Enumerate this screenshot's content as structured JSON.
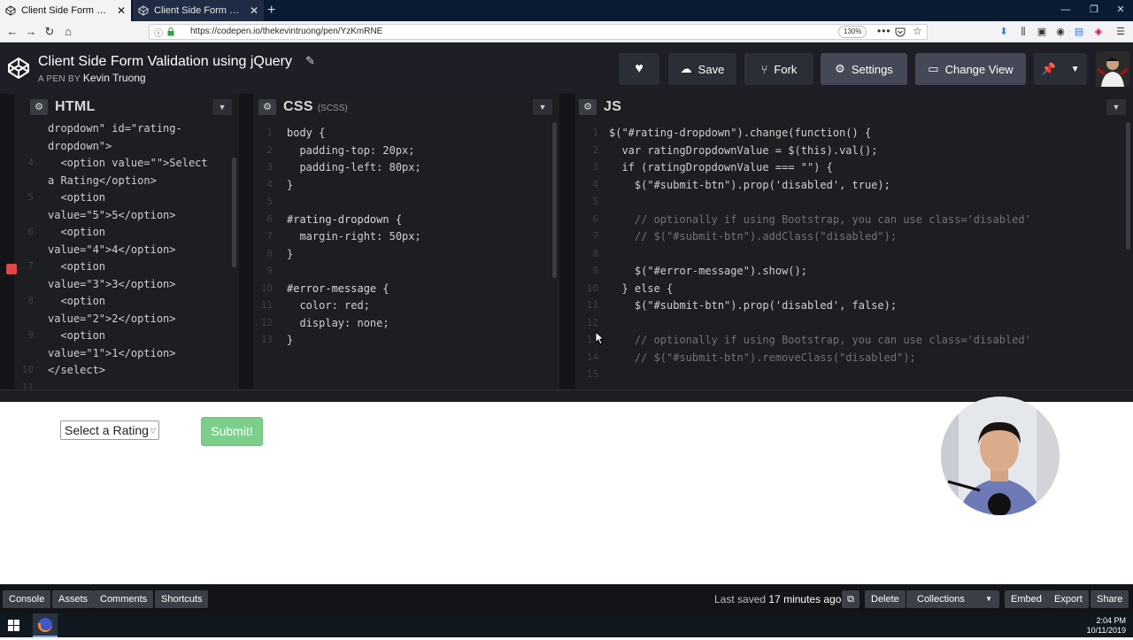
{
  "browser": {
    "tabs": [
      {
        "title": "Client Side Form Validation usi",
        "active": true
      },
      {
        "title": "Client Side Form Validation usi",
        "active": false
      }
    ],
    "url": "https://codepen.io/thekevintruong/pen/YzKmRNE",
    "zoom": "130%"
  },
  "header": {
    "title": "Client Side Form Validation using jQuery",
    "byline_prefix": "A PEN BY",
    "author": "Kevin Truong",
    "buttons": {
      "save": "Save",
      "fork": "Fork",
      "settings": "Settings",
      "change_view": "Change View"
    }
  },
  "panes": {
    "html": {
      "title": "HTML",
      "sub": ""
    },
    "css": {
      "title": "CSS",
      "sub": "(SCSS)"
    },
    "js": {
      "title": "JS",
      "sub": ""
    }
  },
  "html_code": [
    {
      "n": "",
      "t": "dropdown\" id=\"rating-",
      "indent": 0
    },
    {
      "n": "",
      "t": "dropdown\">",
      "indent": 0
    },
    {
      "n": "4",
      "t": "  <option value=\"\">Select",
      "indent": 0
    },
    {
      "n": "",
      "t": "a Rating</option>",
      "indent": 0
    },
    {
      "n": "5",
      "t": "  <option",
      "indent": 0
    },
    {
      "n": "",
      "t": "value=\"5\">5</option>",
      "indent": 0
    },
    {
      "n": "6",
      "t": "  <option",
      "indent": 0
    },
    {
      "n": "",
      "t": "value=\"4\">4</option>",
      "indent": 0
    },
    {
      "n": "7",
      "t": "  <option",
      "indent": 0
    },
    {
      "n": "",
      "t": "value=\"3\">3</option>",
      "indent": 0
    },
    {
      "n": "8",
      "t": "  <option",
      "indent": 0
    },
    {
      "n": "",
      "t": "value=\"2\">2</option>",
      "indent": 0
    },
    {
      "n": "9",
      "t": "  <option",
      "indent": 0
    },
    {
      "n": "",
      "t": "value=\"1\">1</option>",
      "indent": 0
    },
    {
      "n": "10",
      "t": "</select>",
      "indent": 0
    },
    {
      "n": "11",
      "t": "",
      "indent": 0
    }
  ],
  "css_code": [
    {
      "n": "1",
      "t": "body {"
    },
    {
      "n": "2",
      "t": "  padding-top: 20px;"
    },
    {
      "n": "3",
      "t": "  padding-left: 80px;"
    },
    {
      "n": "4",
      "t": "}"
    },
    {
      "n": "5",
      "t": ""
    },
    {
      "n": "6",
      "t": "#rating-dropdown {"
    },
    {
      "n": "7",
      "t": "  margin-right: 50px;"
    },
    {
      "n": "8",
      "t": "}"
    },
    {
      "n": "9",
      "t": ""
    },
    {
      "n": "10",
      "t": "#error-message {"
    },
    {
      "n": "11",
      "t": "  color: red;"
    },
    {
      "n": "12",
      "t": "  display: none;"
    },
    {
      "n": "13",
      "t": "}"
    }
  ],
  "js_code": [
    {
      "n": "1",
      "t": "$(\"#rating-dropdown\").change(function() {"
    },
    {
      "n": "2",
      "t": "  var ratingDropdownValue = $(this).val();"
    },
    {
      "n": "3",
      "t": "  if (ratingDropdownValue === \"\") {"
    },
    {
      "n": "4",
      "t": "    $(\"#submit-btn\").prop('disabled', true);"
    },
    {
      "n": "5",
      "t": ""
    },
    {
      "n": "6",
      "t": "    // optionally if using Bootstrap, you can use class='disabled'"
    },
    {
      "n": "7",
      "t": "    // $(\"#submit-btn\").addClass(\"disabled\");"
    },
    {
      "n": "8",
      "t": ""
    },
    {
      "n": "9",
      "t": "    $(\"#error-message\").show();"
    },
    {
      "n": "10",
      "t": "  } else {"
    },
    {
      "n": "11",
      "t": "    $(\"#submit-btn\").prop('disabled', false);"
    },
    {
      "n": "12",
      "t": ""
    },
    {
      "n": "13",
      "t": "    // optionally if using Bootstrap, you can use class='disabled'"
    },
    {
      "n": "14",
      "t": "    // $(\"#submit-btn\").removeClass(\"disabled\");"
    },
    {
      "n": "15",
      "t": ""
    }
  ],
  "preview": {
    "select_value": "Select a Rating",
    "submit_label": "Submit!"
  },
  "footer": {
    "console": "Console",
    "assets": "Assets",
    "comments": "Comments",
    "shortcuts": "Shortcuts",
    "last_saved_prefix": "Last saved",
    "last_saved_time": "17 minutes ago",
    "delete": "Delete",
    "collections": "Collections",
    "embed": "Embed",
    "export": "Export",
    "share": "Share"
  },
  "taskbar": {
    "time": "2:04 PM",
    "date": "10/11/2019"
  },
  "colors": {
    "editor_bg": "#1d1e22",
    "header_bg": "#1e1f26",
    "submit_green": "#7ccf8b"
  }
}
